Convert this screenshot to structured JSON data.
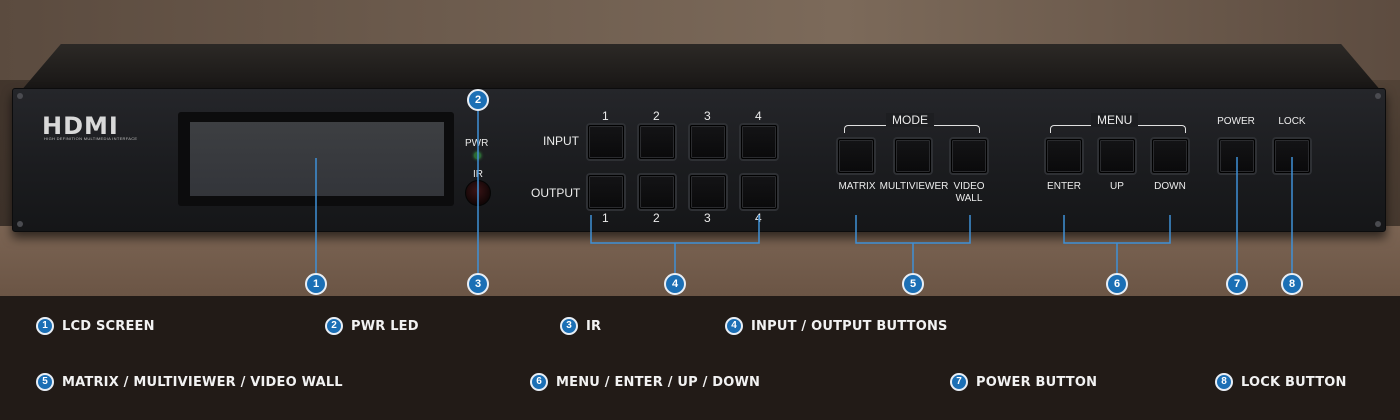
{
  "device": {
    "brand": "HDMI",
    "brand_tagline": "HIGH DEFINITION MULTIMEDIA INTERFACE",
    "pwr_label": "PWR",
    "ir_label": "IR",
    "input_label": "INPUT",
    "output_label": "OUTPUT",
    "input_buttons": [
      "1",
      "2",
      "3",
      "4"
    ],
    "output_buttons": [
      "1",
      "2",
      "3",
      "4"
    ],
    "mode_title": "MODE",
    "mode_buttons": [
      "MATRIX",
      "MULTIVIEWER",
      "VIDEO WALL"
    ],
    "menu_title": "MENU",
    "menu_buttons": [
      "ENTER",
      "UP",
      "DOWN"
    ],
    "power_label": "POWER",
    "lock_label": "LOCK"
  },
  "callout_numbers": [
    "1",
    "2",
    "3",
    "4",
    "5",
    "6",
    "7",
    "8"
  ],
  "legend": [
    {
      "num": "1",
      "text": "LCD SCREEN"
    },
    {
      "num": "2",
      "text": "PWR LED"
    },
    {
      "num": "3",
      "text": "IR"
    },
    {
      "num": "4",
      "text": "INPUT / OUTPUT BUTTONS"
    },
    {
      "num": "5",
      "text": "MATRIX / MULTIVIEWER / VIDEO WALL"
    },
    {
      "num": "6",
      "text": "MENU / ENTER / UP / DOWN"
    },
    {
      "num": "7",
      "text": "POWER BUTTON"
    },
    {
      "num": "8",
      "text": "LOCK BUTTON"
    }
  ],
  "colors": {
    "callout": "#1b6fb5",
    "legend_bg": "#221b17"
  }
}
